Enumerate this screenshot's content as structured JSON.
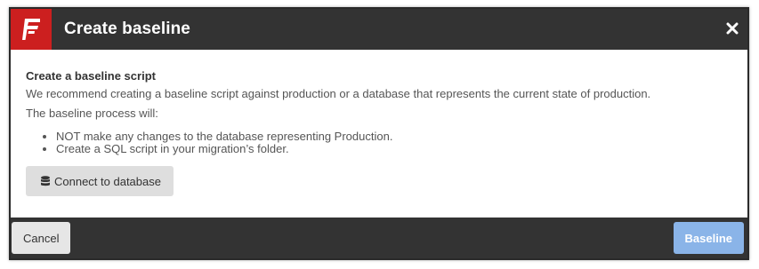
{
  "dialog": {
    "title": "Create baseline",
    "logo_icon": "flyway-logo-icon",
    "close_icon": "close-icon"
  },
  "content": {
    "heading": "Create a baseline script",
    "description": "We recommend creating a baseline script against production or a database that represents the current state of production.",
    "process_intro": "The baseline process will:",
    "bullets": [
      "NOT make any changes to the database representing Production.",
      "Create a SQL script in your migration’s folder."
    ],
    "connect_button": {
      "label": "Connect to database",
      "icon": "database-icon"
    }
  },
  "footer": {
    "cancel_label": "Cancel",
    "baseline_label": "Baseline"
  },
  "colors": {
    "header_bg": "#333333",
    "logo_bg": "#cc1f1f",
    "primary_button_disabled": "#8ab4e8",
    "secondary_button": "#dedede"
  }
}
